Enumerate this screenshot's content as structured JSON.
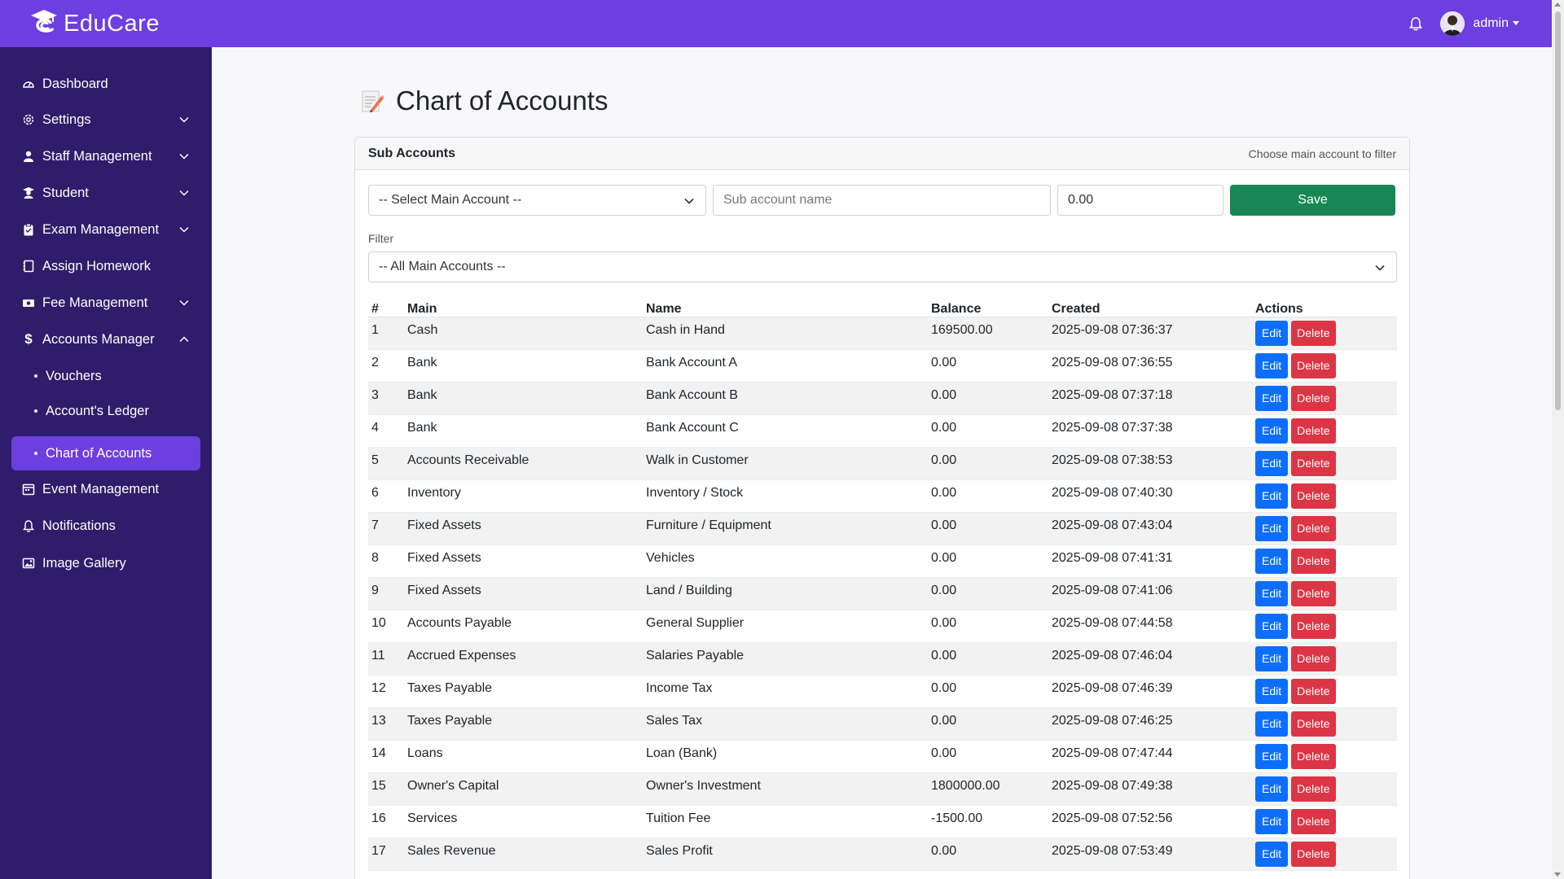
{
  "app": {
    "brand": "EduCare",
    "user": "admin"
  },
  "sidebar": {
    "items": [
      {
        "label": "Dashboard",
        "icon": "dashboard-icon"
      },
      {
        "label": "Settings",
        "icon": "gear-icon"
      },
      {
        "label": "Staff Management",
        "icon": "user-icon"
      },
      {
        "label": "Student",
        "icon": "student-icon"
      },
      {
        "label": "Exam Management",
        "icon": "clipboard-icon"
      },
      {
        "label": "Assign Homework",
        "icon": "notebook-icon"
      },
      {
        "label": "Fee Management",
        "icon": "money-icon"
      },
      {
        "label": "Accounts Manager",
        "icon": "dollar-icon"
      },
      {
        "label": "Event Management",
        "icon": "calendar-icon"
      },
      {
        "label": "Notifications",
        "icon": "bell-icon"
      },
      {
        "label": "Image Gallery",
        "icon": "image-icon"
      }
    ],
    "sub_items": [
      {
        "label": "Vouchers"
      },
      {
        "label": "Account's Ledger"
      },
      {
        "label": "Chart of Accounts"
      }
    ]
  },
  "page": {
    "title": "Chart of Accounts"
  },
  "card": {
    "title": "Sub Accounts",
    "hint": "Choose main account to filter",
    "select_main": "-- Select Main Account --",
    "sub_name_placeholder": "Sub account name",
    "balance_value": "0.00",
    "save_label": "Save",
    "filter_label": "Filter",
    "filter_value": "-- All Main Accounts --"
  },
  "table": {
    "headers": [
      "#",
      "Main",
      "Name",
      "Balance",
      "Created",
      "Actions"
    ],
    "edit_label": "Edit",
    "delete_label": "Delete",
    "rows": [
      [
        "1",
        "Cash",
        "Cash in Hand",
        "169500.00",
        "2025-09-08 07:36:37"
      ],
      [
        "2",
        "Bank",
        "Bank Account A",
        "0.00",
        "2025-09-08 07:36:55"
      ],
      [
        "3",
        "Bank",
        "Bank Account B",
        "0.00",
        "2025-09-08 07:37:18"
      ],
      [
        "4",
        "Bank",
        "Bank Account C",
        "0.00",
        "2025-09-08 07:37:38"
      ],
      [
        "5",
        "Accounts Receivable",
        "Walk in Customer",
        "0.00",
        "2025-09-08 07:38:53"
      ],
      [
        "6",
        "Inventory",
        "Inventory / Stock",
        "0.00",
        "2025-09-08 07:40:30"
      ],
      [
        "7",
        "Fixed Assets",
        "Furniture / Equipment",
        "0.00",
        "2025-09-08 07:43:04"
      ],
      [
        "8",
        "Fixed Assets",
        "Vehicles",
        "0.00",
        "2025-09-08 07:41:31"
      ],
      [
        "9",
        "Fixed Assets",
        "Land / Building",
        "0.00",
        "2025-09-08 07:41:06"
      ],
      [
        "10",
        "Accounts Payable",
        "General Supplier",
        "0.00",
        "2025-09-08 07:44:58"
      ],
      [
        "11",
        "Accrued Expenses",
        "Salaries Payable",
        "0.00",
        "2025-09-08 07:46:04"
      ],
      [
        "12",
        "Taxes Payable",
        "Income Tax",
        "0.00",
        "2025-09-08 07:46:39"
      ],
      [
        "13",
        "Taxes Payable",
        "Sales Tax",
        "0.00",
        "2025-09-08 07:46:25"
      ],
      [
        "14",
        "Loans",
        "Loan (Bank)",
        "0.00",
        "2025-09-08 07:47:44"
      ],
      [
        "15",
        "Owner's Capital",
        "Owner's Investment",
        "1800000.00",
        "2025-09-08 07:49:38"
      ],
      [
        "16",
        "Services",
        "Tuition Fee",
        "-1500.00",
        "2025-09-08 07:52:56"
      ],
      [
        "17",
        "Sales Revenue",
        "Sales Profit",
        "0.00",
        "2025-09-08 07:53:49"
      ]
    ]
  }
}
